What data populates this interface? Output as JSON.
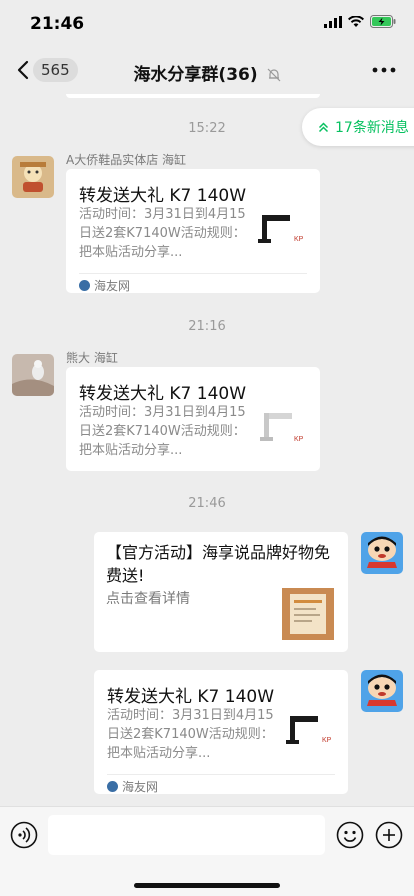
{
  "status": {
    "time": "21:46"
  },
  "nav": {
    "back_count": "565",
    "title": "海水分享群(36)"
  },
  "new_messages": {
    "label": "17条新消息"
  },
  "messages": [
    {
      "time": "15:22",
      "sender": "A大侨鞋品实体店 海缸",
      "title": "转发送大礼 K7 140W",
      "desc": "活动时间：3月31日到4月15日送2套K7140W活动规则：把本贴活动分享...",
      "source": "海友网"
    },
    {
      "time": "21:16",
      "sender": "熊大 海缸",
      "title": "转发送大礼 K7 140W",
      "desc": "活动时间：3月31日到4月15日送2套K7140W活动规则：把本贴活动分享..."
    },
    {
      "time": "21:46",
      "title": "【官方活动】海享说品牌好物免费送!",
      "desc": "点击查看详情"
    },
    {
      "title": "转发送大礼 K7 140W",
      "desc": "活动时间：3月31日到4月15日送2套K7140W活动规则：把本贴活动分享...",
      "source": "海友网"
    }
  ],
  "colors": {
    "accent": "#07c160",
    "background": "#ededed"
  }
}
